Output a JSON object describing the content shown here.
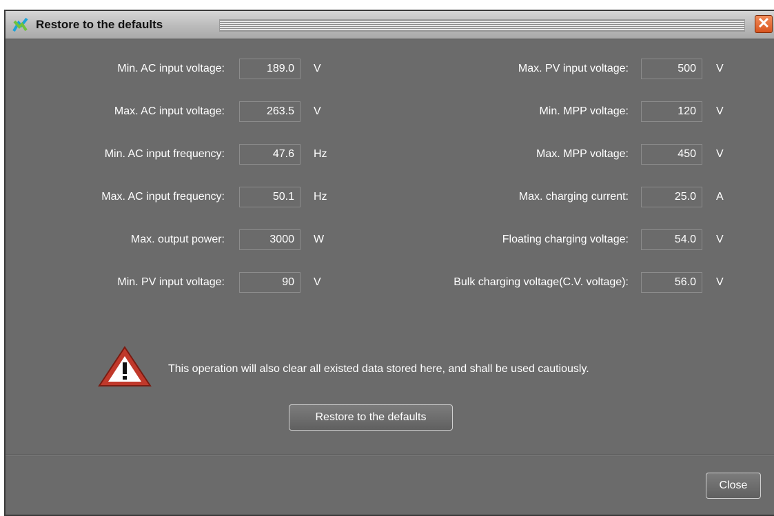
{
  "window": {
    "title": "Restore to the defaults",
    "close_glyph": "✕"
  },
  "left_fields": [
    {
      "label": "Min. AC input voltage:",
      "value": "189.0",
      "unit": "V"
    },
    {
      "label": "Max. AC input voltage:",
      "value": "263.5",
      "unit": "V"
    },
    {
      "label": "Min. AC input frequency:",
      "value": "47.6",
      "unit": "Hz"
    },
    {
      "label": "Max. AC input frequency:",
      "value": "50.1",
      "unit": "Hz"
    },
    {
      "label": "Max. output power:",
      "value": "3000",
      "unit": "W"
    },
    {
      "label": "Min. PV input voltage:",
      "value": "90",
      "unit": "V"
    }
  ],
  "right_fields": [
    {
      "label": "Max. PV input voltage:",
      "value": "500",
      "unit": "V"
    },
    {
      "label": "Min. MPP voltage:",
      "value": "120",
      "unit": "V"
    },
    {
      "label": "Max. MPP voltage:",
      "value": "450",
      "unit": "V"
    },
    {
      "label": "Max. charging current:",
      "value": "25.0",
      "unit": "A"
    },
    {
      "label": "Floating charging voltage:",
      "value": "54.0",
      "unit": "V"
    },
    {
      "label": "Bulk charging voltage(C.V. voltage):",
      "value": "56.0",
      "unit": "V"
    }
  ],
  "warning": {
    "icon": "warning-triangle-icon",
    "text": "This operation will also clear all existed data stored here, and shall be used cautiously."
  },
  "buttons": {
    "restore_label": "Restore to the defaults",
    "close_label": "Close"
  },
  "colors": {
    "panel_bg": "#6b6b6b",
    "text": "#ffffff",
    "close_accent": "#d9541e",
    "warning_red": "#c0392b"
  }
}
